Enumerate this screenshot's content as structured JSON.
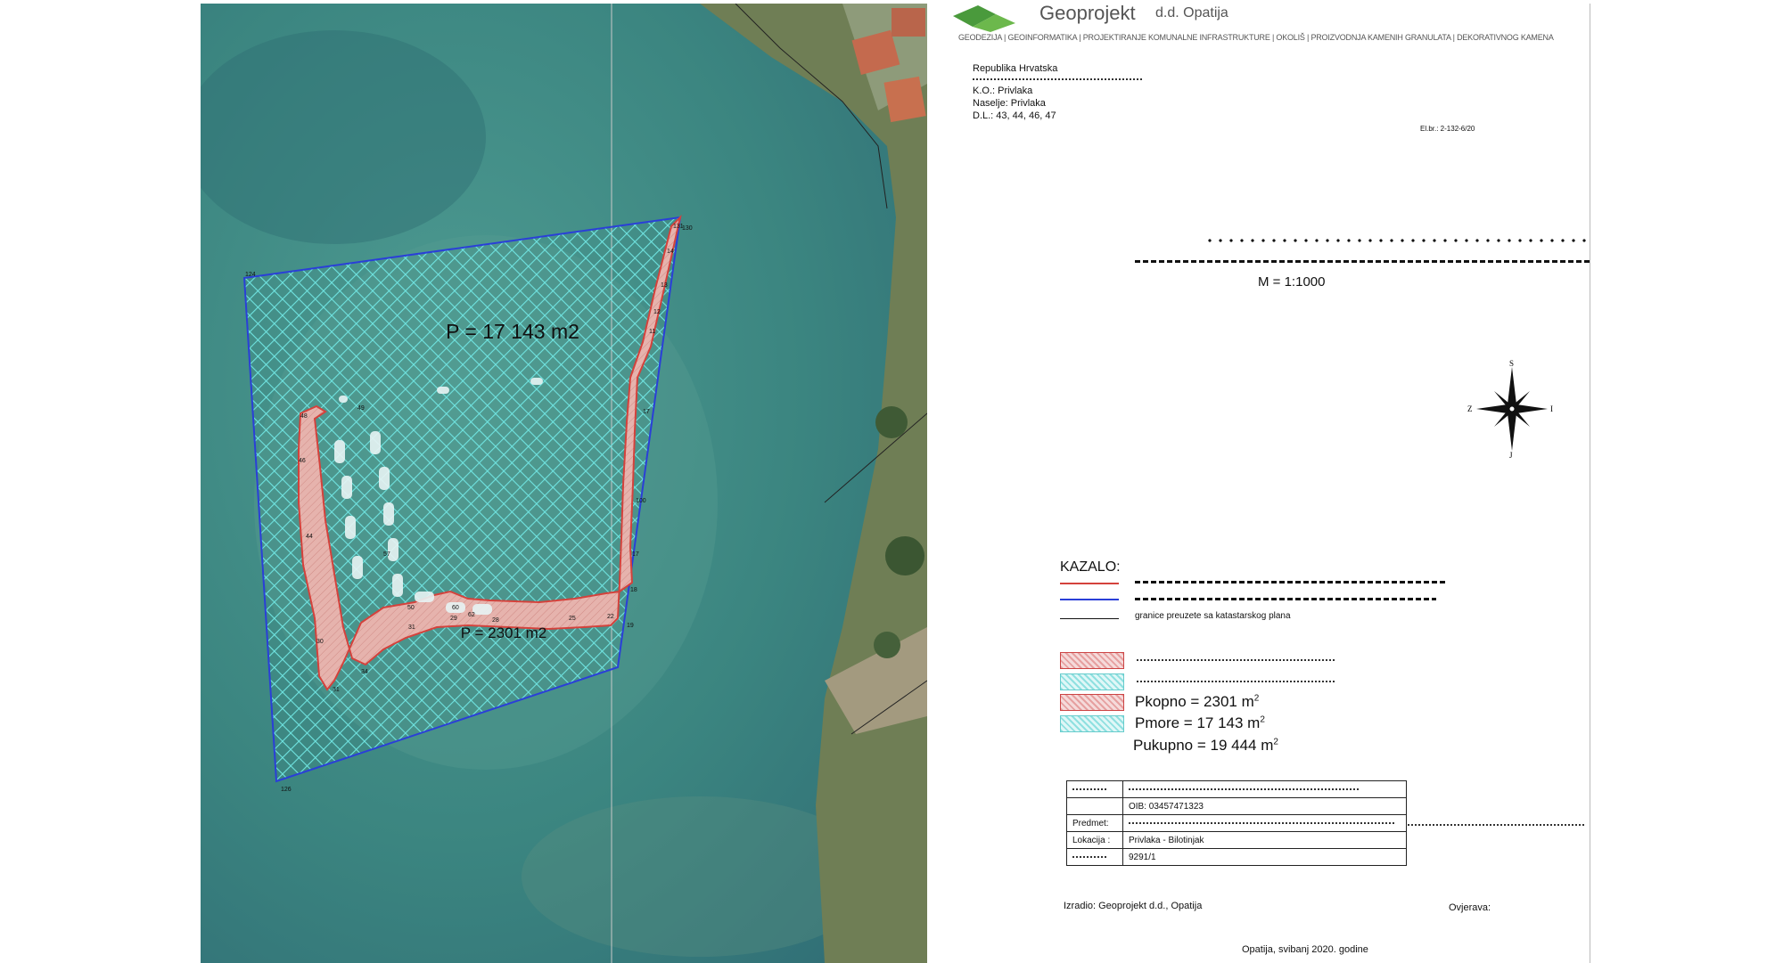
{
  "company": {
    "name": "Geoprojekt",
    "suffix": "d.d. Opatija",
    "services": "GEODEZIJA | GEOINFORMATIKA | PROJEKTIRANJE KOMUNALNE INFRASTRUKTURE | OKOLIŠ | PROIZVODNJA KAMENIH GRANULATA | DEKORATIVNOG KAMENA"
  },
  "header": {
    "lines": [
      "Republika Hrvatska",
      "K.O.: Privlaka",
      "Naselje: Privlaka",
      "D.L.: 43, 44, 46, 47"
    ],
    "el_br": "El.br.: 2-132-6/20",
    "scale": "M = 1:1000"
  },
  "map": {
    "sea_area_label": "P = 17 143 m2",
    "land_area_label": "P = 2301 m2",
    "corner_labels": [
      "124",
      "126",
      "130"
    ],
    "colors": {
      "sea_hatch": "#5fd6d6",
      "land_fill": "#e9b7b4",
      "land_outline": "#d4423c",
      "sea_outline": "#2a3fd8"
    }
  },
  "legend": {
    "title": "KAZALO:",
    "line_item_cadastral": "granice preuzete sa katastarskog plana",
    "land_area": "Pkopno = 2301 m",
    "sea_area": "Pmore = 17 143 m",
    "total_area": "Pukupno = 19 444 m",
    "exponent": "2"
  },
  "title_block": {
    "oib": "OIB: 03457471323",
    "predmet_label": "Predmet:",
    "lokacija_label": "Lokacija :",
    "lokacija_value": "Privlaka - Bilotinjak",
    "parcel": "9291/1"
  },
  "footer": {
    "izradio": "Izradio: Geoprojekt d.d., Opatija",
    "ovjerava": "Ovjerava:",
    "date": "Opatija, svibanj 2020. godine"
  },
  "compass": {
    "n": "S",
    "s": "J",
    "e": "I",
    "w": "Z"
  }
}
